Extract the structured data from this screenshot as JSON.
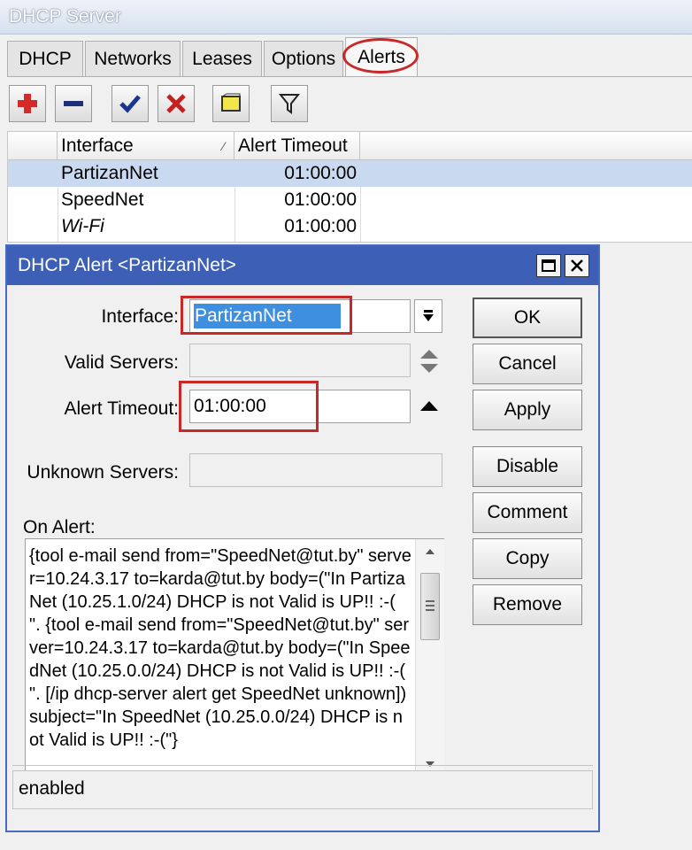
{
  "window": {
    "title": "DHCP Server"
  },
  "tabs": [
    {
      "label": "DHCP"
    },
    {
      "label": "Networks"
    },
    {
      "label": "Leases"
    },
    {
      "label": "Options"
    },
    {
      "label": "Alerts",
      "active": true
    }
  ],
  "toolbar": {
    "buttons": [
      "add-icon",
      "remove-icon",
      "enable-check-icon",
      "disable-x-icon",
      "comment-note-icon",
      "filter-icon"
    ]
  },
  "table": {
    "columns": [
      "Interface",
      "Alert Timeout"
    ],
    "rows": [
      {
        "interface": "PartizanNet",
        "timeout": "01:00:00",
        "selected": true
      },
      {
        "interface": "SpeedNet",
        "timeout": "01:00:00"
      },
      {
        "interface": "Wi-Fi",
        "timeout": "01:00:00",
        "disabled": true
      }
    ]
  },
  "dialog": {
    "title": "DHCP Alert <PartizanNet>",
    "labels": {
      "interface": "Interface:",
      "valid_servers": "Valid Servers:",
      "alert_timeout": "Alert Timeout:",
      "unknown_servers": "Unknown Servers:",
      "on_alert": "On Alert:"
    },
    "fields": {
      "interface": "PartizanNet",
      "valid_servers": "",
      "alert_timeout": "01:00:00",
      "unknown_servers": "",
      "on_alert": "{tool e-mail send from=\"SpeedNet@tut.by\" server=10.24.3.17 to=karda@tut.by body=(\"In PartizaNet (10.25.1.0/24) DHCP is not Valid is UP!! :-( \". {tool e-mail send from=\"SpeedNet@tut.by\" server=10.24.3.17 to=karda@tut.by body=(\"In SpeedNet (10.25.0.0/24) DHCP is not Valid is UP!! :-( \". [/ip dhcp-server alert get SpeedNet unknown]) subject=\"In SpeedNet (10.25.0.0/24) DHCP is not Valid is UP!! :-(\"}"
    },
    "buttons": {
      "ok": "OK",
      "cancel": "Cancel",
      "apply": "Apply",
      "disable": "Disable",
      "comment": "Comment",
      "copy": "Copy",
      "remove": "Remove"
    },
    "status": "enabled"
  },
  "colors": {
    "dialog_titlebar": "#3d5fb6",
    "selection": "#c9d9ef",
    "highlight_red": "#c82828"
  }
}
